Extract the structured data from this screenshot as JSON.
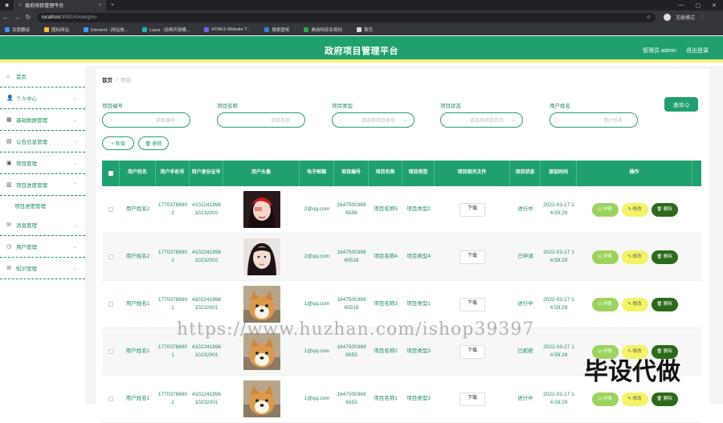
{
  "browser": {
    "tab_title": "政府项目管理平台",
    "tab_close": "×",
    "new_tab": "+",
    "url_host": "localhost",
    "url_rest": ":8081/#/xiangmu",
    "profile": "无痕模式",
    "win_controls": [
      "—",
      "▢",
      "✕"
    ],
    "nav": [
      "←",
      "→",
      "↻"
    ],
    "bookmarks": [
      {
        "label": "百度翻译",
        "color": "#4a8cf0"
      },
      {
        "label": "图标网站",
        "color": "#f0c040"
      },
      {
        "label": "Element - 网站快...",
        "color": "#3aa0ff"
      },
      {
        "label": "Layui - 经典开源模...",
        "color": "#20b2aa"
      },
      {
        "label": "HTML5 Website T...",
        "color": "#7a5cf0"
      },
      {
        "label": "搜索壁纸",
        "color": "#3a7bd5"
      },
      {
        "label": "奥纳特原名规则",
        "color": "#2aa84a"
      },
      {
        "label": "首页",
        "color": "#ddd"
      }
    ]
  },
  "header": {
    "title": "政府项目管理平台",
    "admin": "管理员 admin",
    "logout": "退出登录"
  },
  "sidebar": {
    "items": [
      {
        "label": "首页",
        "icon": "⌂",
        "caret": ""
      },
      {
        "label": "个人中心",
        "icon": "👤",
        "caret": "⌄"
      },
      {
        "label": "基础数据管理",
        "icon": "▦",
        "caret": "⌄"
      },
      {
        "label": "公告信息管理",
        "icon": "▤",
        "caret": "⌄"
      },
      {
        "label": "项目管理",
        "icon": "▣",
        "caret": "⌄"
      },
      {
        "label": "项目进度管理",
        "icon": "▥",
        "caret": "⌃"
      },
      {
        "label": "消息管理",
        "icon": "✉",
        "caret": "⌄"
      },
      {
        "label": "用户管理",
        "icon": "◷",
        "caret": "⌄"
      },
      {
        "label": "知识管理",
        "icon": "✉",
        "caret": "⌄"
      }
    ],
    "submenu": "项目进度管理"
  },
  "breadcrumb": {
    "home": "首页",
    "sep": "/",
    "current": "项目"
  },
  "filters": [
    {
      "label": "项目编号",
      "placeholder": "项目编号",
      "caret": ""
    },
    {
      "label": "项目名称",
      "placeholder": "项目名称",
      "caret": ""
    },
    {
      "label": "项目类型",
      "placeholder": "请选择项目类型",
      "caret": "⌄"
    },
    {
      "label": "项目状态",
      "placeholder": "请选择项目状态",
      "caret": "⌄"
    },
    {
      "label": "用户姓名",
      "placeholder": "用户姓名",
      "caret": ""
    }
  ],
  "search_btn": "查询 Q",
  "add_btn": "+ 新增",
  "delete_btn": "🗑 删除",
  "table": {
    "headers": [
      "",
      "用户姓名",
      "用户手机号",
      "用户身份证号",
      "用户头像",
      "电子邮箱",
      "项目编号",
      "项目名称",
      "项目类型",
      "项目相关文件",
      "项目状态",
      "添加时间",
      "操作"
    ],
    "download": "下载",
    "actions": {
      "detail": "◎ 详情",
      "edit": "✎ 修改",
      "delete": "🗑 删除"
    },
    "rows": [
      {
        "name": "用户姓名2",
        "phone": "17703786902",
        "idno": "410224199610232002",
        "email": "2@qq.com",
        "pno": "16475003696556",
        "pname": "项目名称5",
        "ptype": "项目类型2",
        "status": "进行中",
        "time": "2022-03-17 14:59:29",
        "avatar": "a"
      },
      {
        "name": "用户姓名2",
        "phone": "17703786902",
        "idno": "410224199610232002",
        "email": "2@qq.com",
        "pno": "164750036965518",
        "pname": "项目名称4",
        "ptype": "项目类型4",
        "status": "已申请",
        "time": "2022-03-17 14:59:29",
        "avatar": "b"
      },
      {
        "name": "用户姓名1",
        "phone": "17703786901",
        "idno": "410224199610232001",
        "email": "1@qq.com",
        "pno": "164750036965519",
        "pname": "项目名称3",
        "ptype": "项目类型1",
        "status": "进行中",
        "time": "2022-03-17 14:59:29",
        "avatar": "c"
      },
      {
        "name": "用户姓名1",
        "phone": "17703786901",
        "idno": "410224199610232001",
        "email": "1@qq.com",
        "pno": "16475003696553",
        "pname": "项目名称2",
        "ptype": "项目类型3",
        "status": "已拒绝",
        "time": "2022-03-17 14:59:29",
        "avatar": "c"
      },
      {
        "name": "用户姓名1",
        "phone": "17703786901",
        "idno": "410224199610232001",
        "email": "1@qq.com",
        "pno": "16475003696553",
        "pname": "项目名称1",
        "ptype": "项目类型3",
        "status": "进行中",
        "time": "2022-03-17 14:59:29",
        "avatar": "c"
      }
    ]
  },
  "watermark": {
    "url": "https://www.huzhan.com/ishop39397",
    "text": "毕设代做"
  }
}
